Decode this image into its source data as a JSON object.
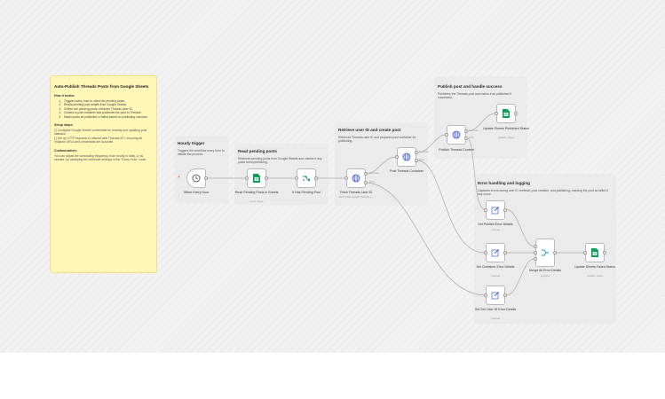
{
  "overview": {
    "title": "Auto-Publish Threads Posts from Google Sheets",
    "how_title": "How it works:",
    "steps": [
      "Triggers every hour to check for pending posts.",
      "Reads pending post details from Google Sheets.",
      "If there are pending posts, retrieves Threads User ID.",
      "Creates a post container and publishes the post to Threads.",
      "Marks posts as published or failed based on publishing outcome."
    ],
    "setup_title": "Setup steps:",
    "setup": [
      "[ ] Configure Google Sheets credentials for reading and updating post statuses.",
      "[ ] Set up HTTP requests to interact with Threads API, ensuring all endpoint URLs and credentials are accurate."
    ],
    "custom_title": "Customization:",
    "custom_text": "You can adjust the scheduling frequency, from hourly to daily, or as needed, by modifying the schedule settings in the \"Every Hour\" node."
  },
  "sections": {
    "hourly": {
      "title": "Hourly trigger",
      "desc": "Triggers the workflow every hour to initiate the process."
    },
    "read": {
      "title": "Read pending posts",
      "desc": "Retrieves pending posts from Google Sheets and checks if any posts need publishing."
    },
    "retrieve": {
      "title": "Retrieve user ID and create post",
      "desc": "Retrieves Threads user ID and prepares post container for publishing."
    },
    "publish": {
      "title": "Publish post and handle success",
      "desc": "Publishes the Threads post and marks it as published if successful."
    },
    "error": {
      "title": "Error handling and logging",
      "desc": "Captures errors during user ID retrieval, post creation, and publishing, marking the post as failed if any occur."
    }
  },
  "nodes": {
    "every_hour": {
      "label": "When Every Hour",
      "icon": "clock-icon"
    },
    "read_sheets": {
      "label": "Read Pending Posts in Sheets",
      "sub": "read: sheet",
      "icon": "google-sheets-icon"
    },
    "if_pending": {
      "label": "If Has Pending Post",
      "icon": "if-branch-icon"
    },
    "fetch_user": {
      "label": "Fetch Threads User ID",
      "sub": "GET: https://graph.threads.n...",
      "icon": "globe-icon"
    },
    "post_container": {
      "label": "Post Threads Container",
      "icon": "globe-icon"
    },
    "publish_content": {
      "label": "Publish Threads Content",
      "icon": "globe-icon"
    },
    "update_published": {
      "label": "Update Sheets Published Status",
      "sub": "update: sheet",
      "icon": "google-sheets-icon"
    },
    "set_publish_err": {
      "label": "Set Publish Error Details",
      "sub": "manual",
      "icon": "edit-icon"
    },
    "set_container_err": {
      "label": "Set Container Error Details",
      "sub": "manual",
      "icon": "edit-icon"
    },
    "set_user_err": {
      "label": "Set Get User ID Error Details",
      "sub": "manual",
      "icon": "edit-icon"
    },
    "merge_errors": {
      "label": "Merge All Error Details",
      "sub": "append",
      "icon": "merge-icon"
    },
    "update_failed": {
      "label": "Update Sheets Failed Status",
      "sub": "update: sheet",
      "icon": "google-sheets-icon"
    }
  },
  "port_labels": {
    "success": "Success",
    "error": "Error"
  },
  "colors": {
    "accent": "#ff6d5a",
    "sheets_green": "#0f9d58",
    "globe_blue": "#3b5bd9",
    "sticky_yellow": "#fff7b8"
  }
}
